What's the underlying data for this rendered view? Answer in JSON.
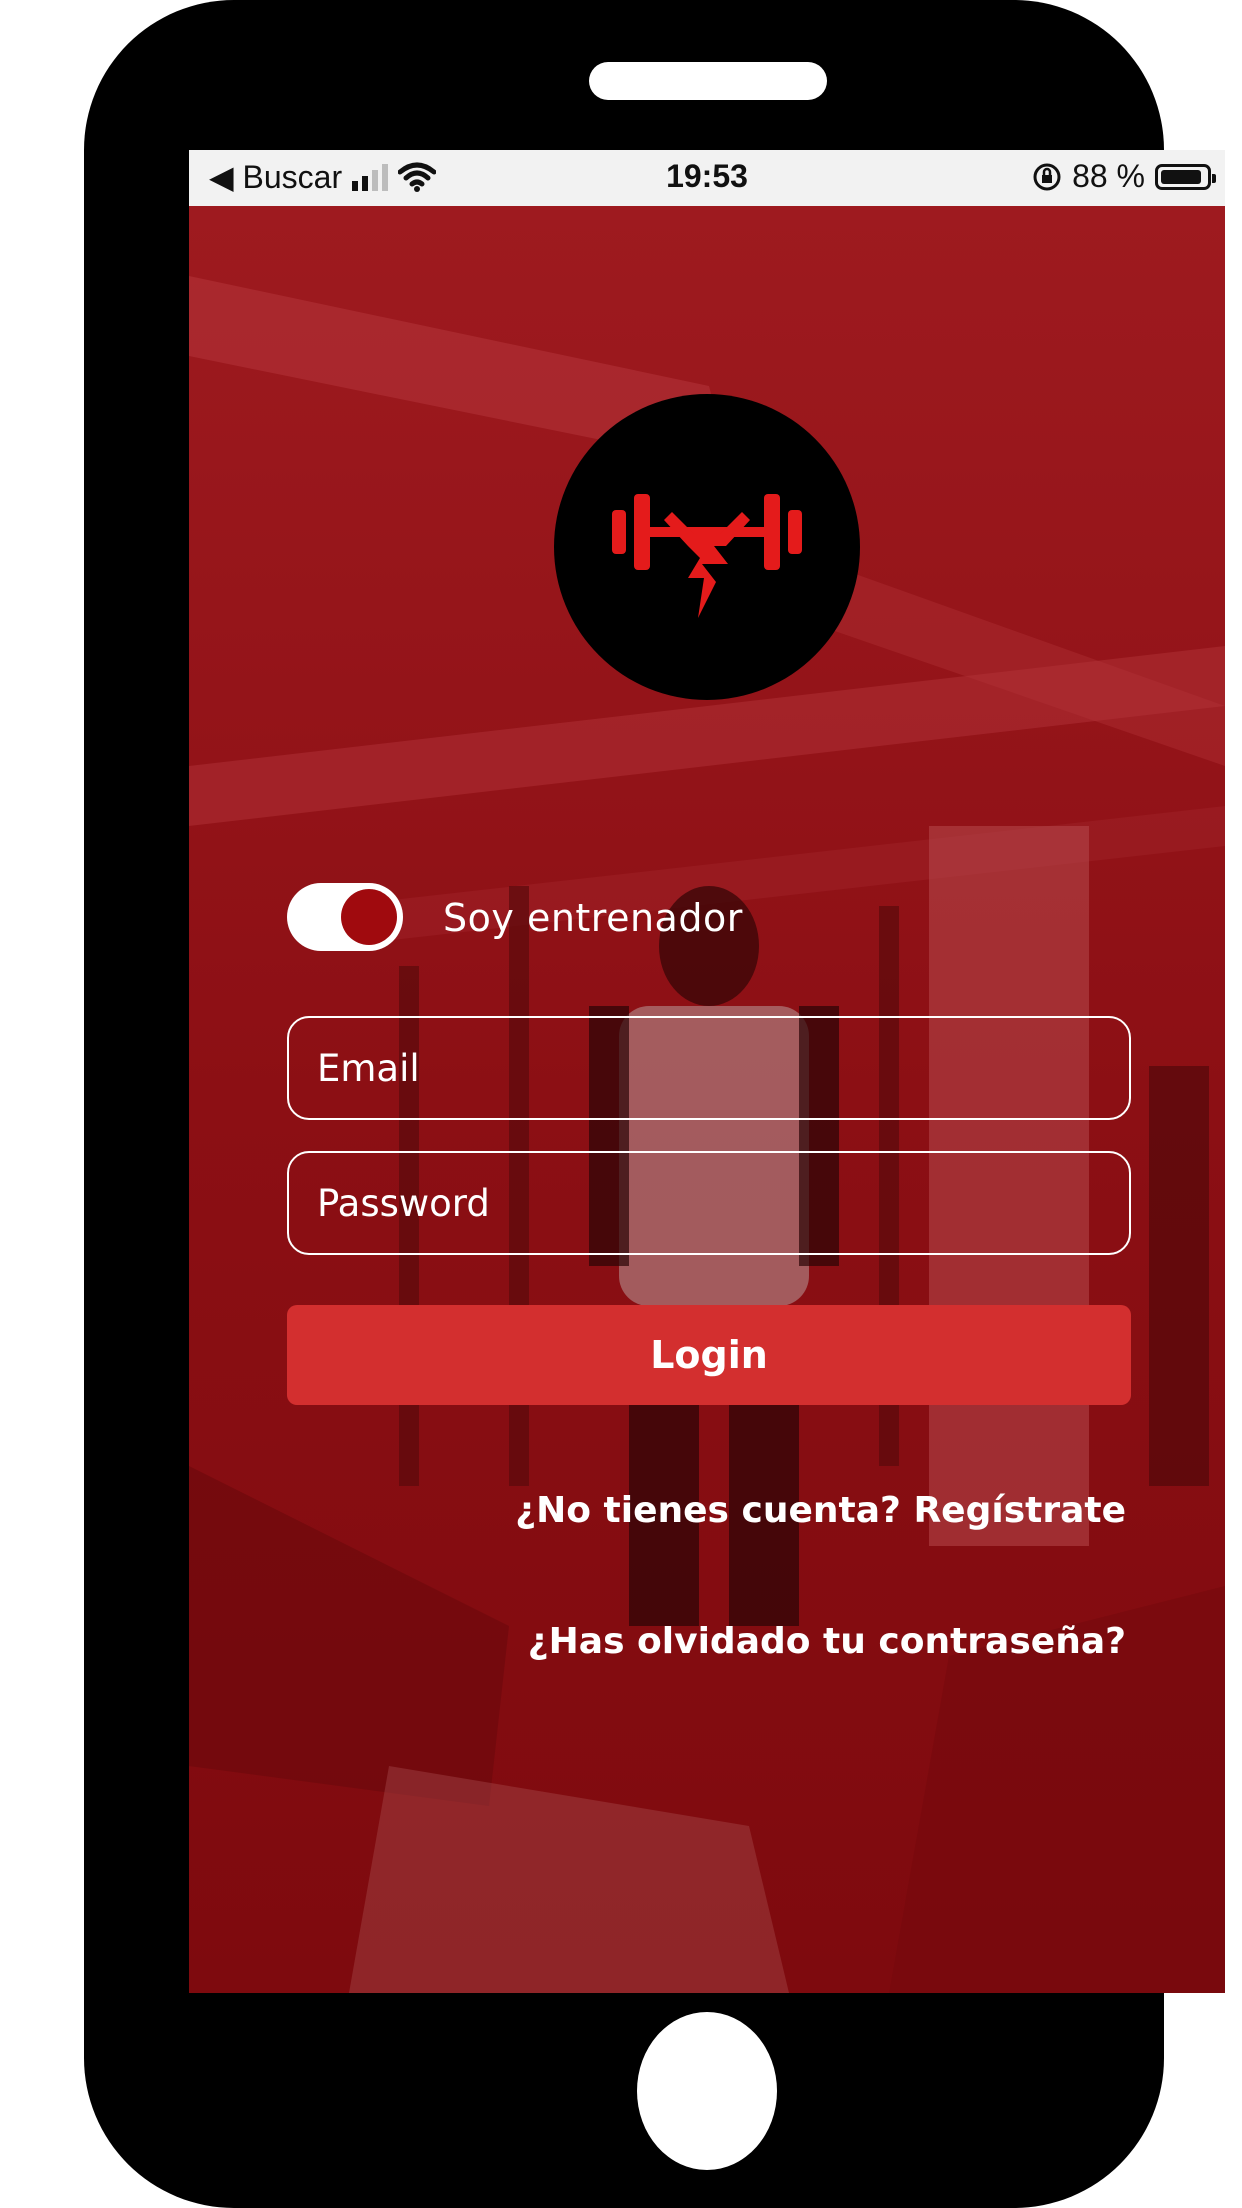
{
  "status_bar": {
    "back_label": "◀ Buscar",
    "time": "19:53",
    "battery_text": "88 %",
    "battery_level": 0.88
  },
  "logo": {
    "icon": "barbell-lightning-logo",
    "color": "#e41b1b"
  },
  "trainer_toggle": {
    "label": "Soy entrenador",
    "on": true
  },
  "form": {
    "email_placeholder": "Email",
    "password_placeholder": "Password",
    "login_label": "Login"
  },
  "links": {
    "register": "¿No tienes cuenta? Regístrate",
    "forgot_password": "¿Has olvidado tu contraseña?"
  },
  "colors": {
    "overlay_red": "#8e0a10",
    "button_red": "#d32f2f",
    "toggle_knob": "#a00a0e"
  }
}
